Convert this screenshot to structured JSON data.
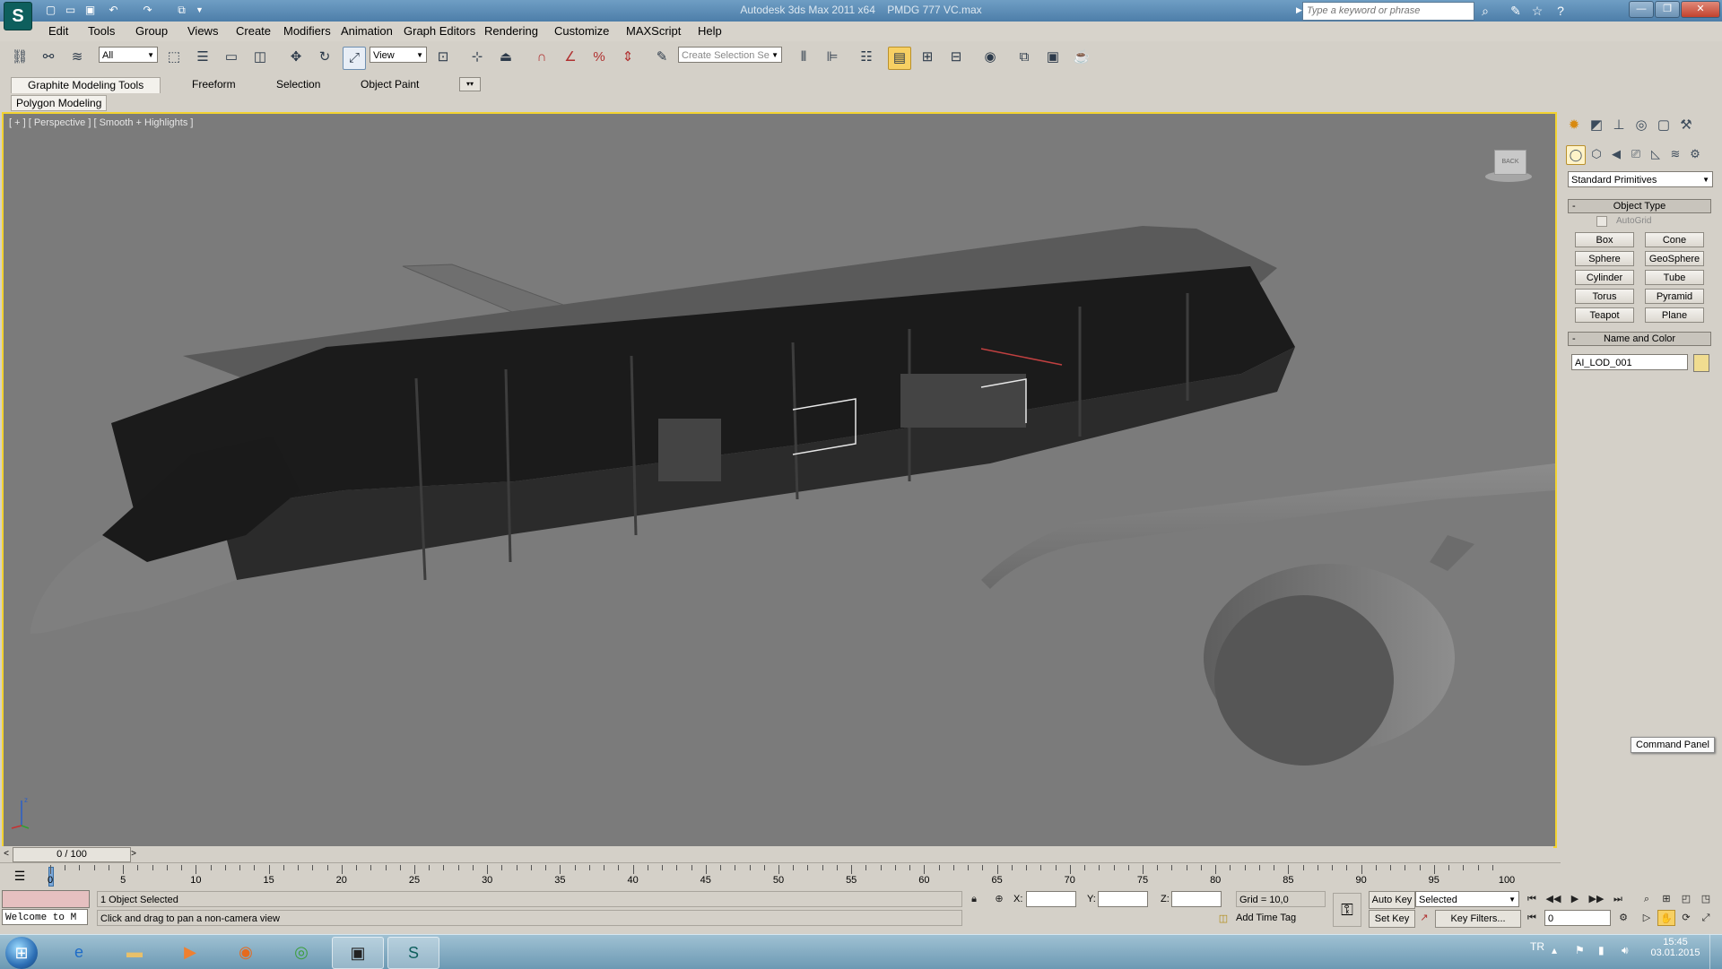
{
  "title_bar": {
    "app_title": "Autodesk 3ds Max  2011 x64",
    "file_name": "PMDG 777 VC.max",
    "search_placeholder": "Type a keyword or phrase",
    "quick_access_icons": [
      "new-file-icon",
      "open-file-icon",
      "save-icon",
      "undo-icon",
      "redo-icon",
      "project-folder-icon"
    ],
    "window_controls": [
      "minimize",
      "maximize",
      "close"
    ]
  },
  "menu": {
    "items": [
      "Edit",
      "Tools",
      "Group",
      "Views",
      "Create",
      "Modifiers",
      "Animation",
      "Graph Editors",
      "Rendering",
      "Customize",
      "MAXScript",
      "Help"
    ]
  },
  "toolbar": {
    "selection_filter": "All",
    "reference_coord": "View",
    "named_selection_placeholder": "Create Selection Se"
  },
  "ribbon": {
    "tabs": [
      "Graphite Modeling Tools",
      "Freeform",
      "Selection",
      "Object Paint"
    ],
    "panel": "Polygon Modeling"
  },
  "viewport": {
    "label": "[ + ] [ Perspective ] [ Smooth + Highlights ]",
    "viewcube_label": "BACK"
  },
  "command_panel": {
    "category": "Standard Primitives",
    "object_type_title": "Object Type",
    "autogrid_label": "AutoGrid",
    "primitives": [
      "Box",
      "Cone",
      "Sphere",
      "GeoSphere",
      "Cylinder",
      "Tube",
      "Torus",
      "Pyramid",
      "Teapot",
      "Plane"
    ],
    "name_color_title": "Name and Color",
    "object_name": "AI_LOD_001",
    "object_color": "#f0dc90",
    "tooltip": "Command Panel"
  },
  "timeline": {
    "frame_display": "0 / 100",
    "ticks": [
      "0",
      "5",
      "10",
      "15",
      "20",
      "25",
      "30",
      "35",
      "40",
      "45",
      "50",
      "55",
      "60",
      "65",
      "70",
      "75",
      "80",
      "85",
      "90",
      "95",
      "100"
    ]
  },
  "status": {
    "maxscript_listener": "Welcome to M",
    "selection_info": "1 Object Selected",
    "prompt": "Click and drag to pan a non-camera view",
    "x_label": "X:",
    "y_label": "Y:",
    "z_label": "Z:",
    "x_value": "",
    "y_value": "",
    "z_value": "",
    "grid": "Grid = 10,0",
    "add_time_tag": "Add Time Tag",
    "auto_key": "Auto Key",
    "set_key": "Set Key",
    "key_mode": "Selected",
    "key_filters": "Key Filters...",
    "current_frame": "0"
  },
  "taskbar": {
    "language": "TR",
    "time": "15:45",
    "date": "03.01.2015"
  }
}
